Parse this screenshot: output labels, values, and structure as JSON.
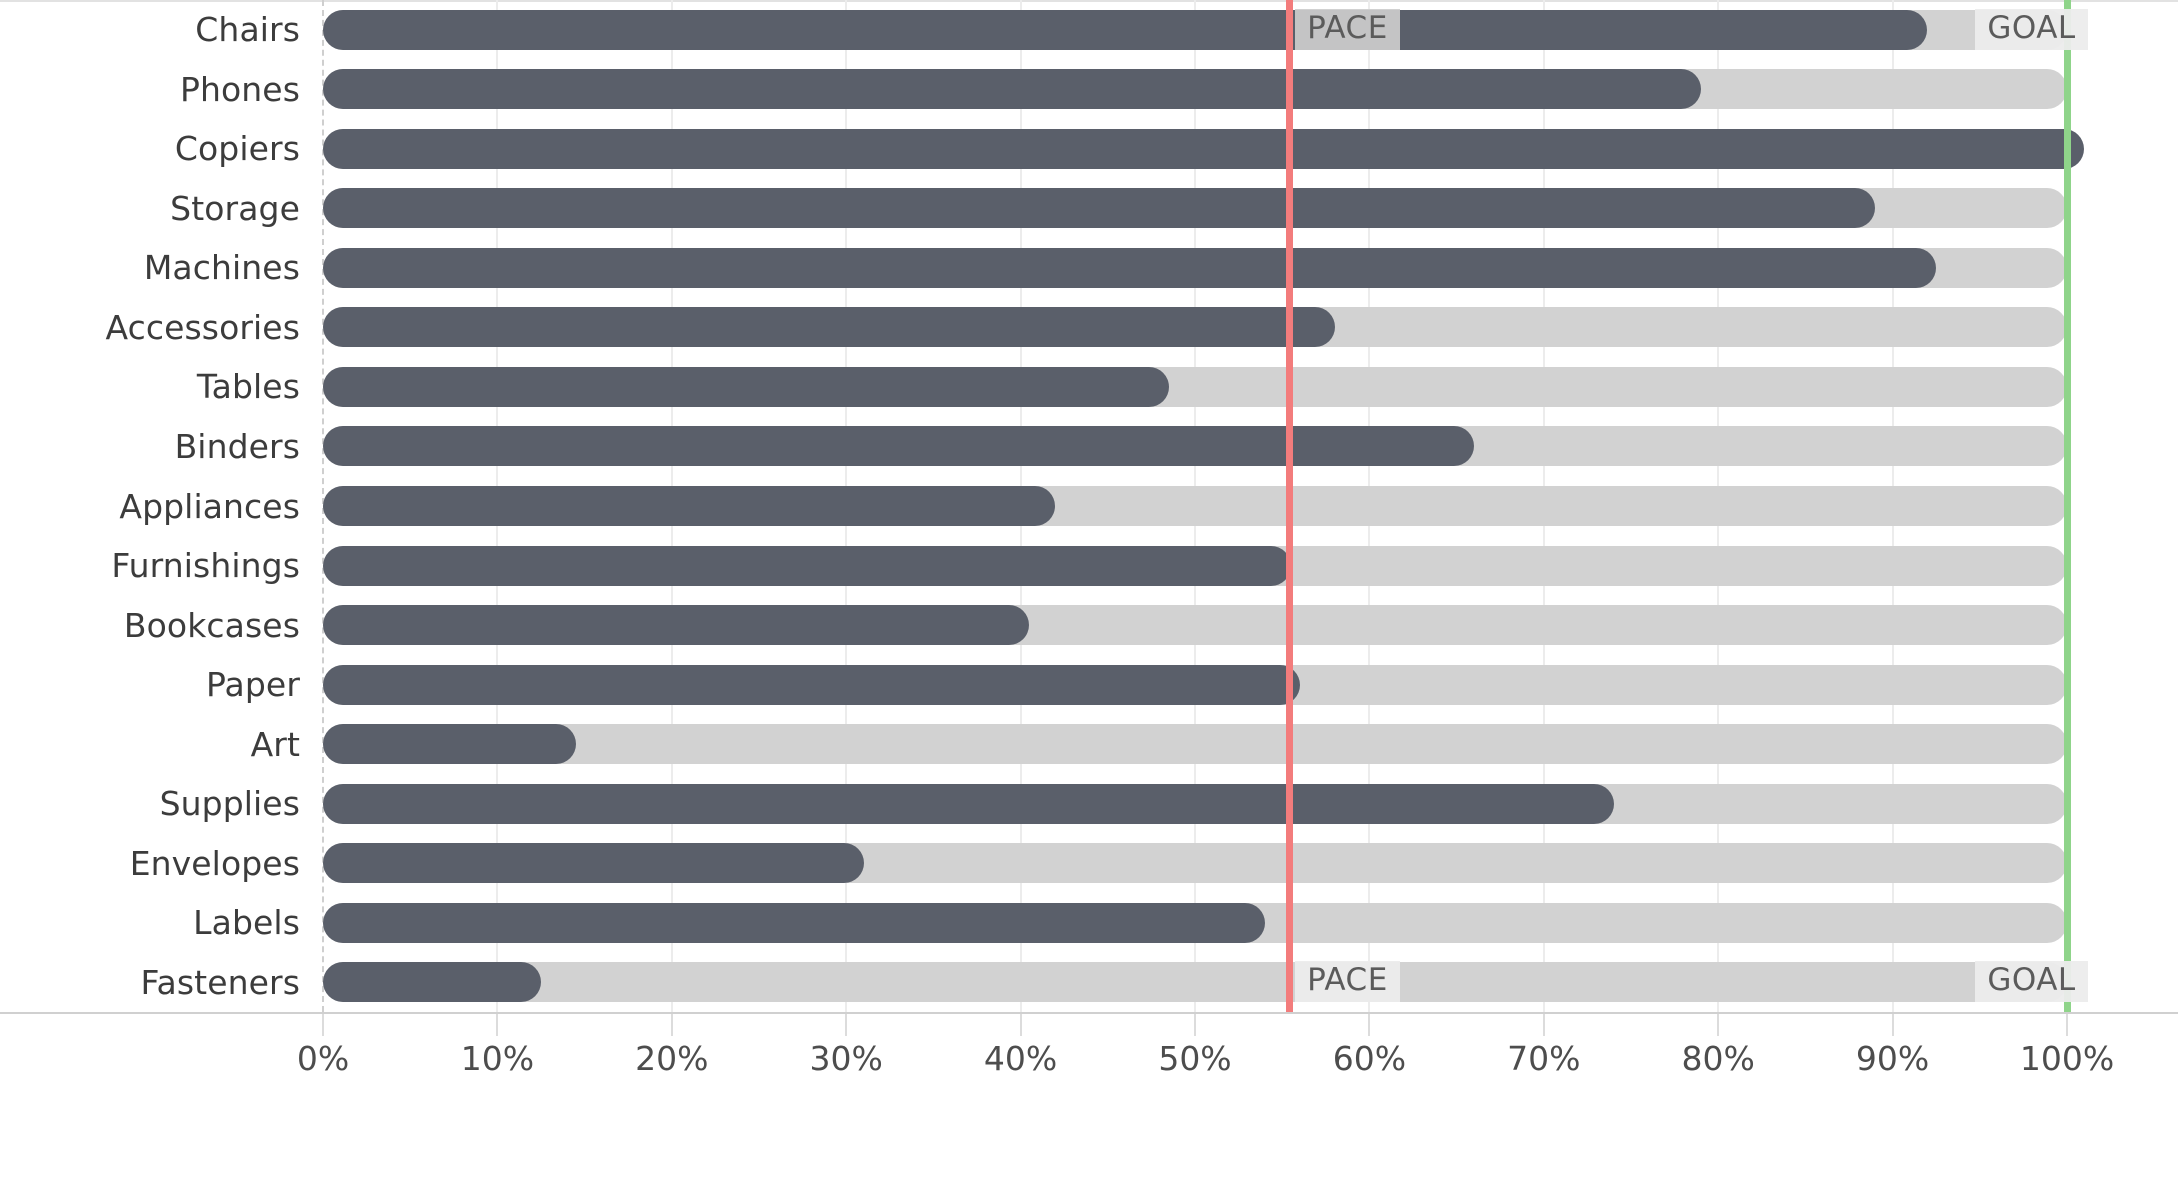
{
  "chart_data": {
    "type": "bar",
    "title": "",
    "subtitle": "",
    "xlabel": "",
    "ylabel": "",
    "orientation": "horizontal",
    "xlim": [
      0,
      100
    ],
    "grid": true,
    "legend_position": "none",
    "x_tick_labels": [
      "0%",
      "10%",
      "20%",
      "30%",
      "40%",
      "50%",
      "60%",
      "70%",
      "80%",
      "90%",
      "100%"
    ],
    "x_tick_values": [
      0,
      10,
      20,
      30,
      40,
      50,
      60,
      70,
      80,
      90,
      100
    ],
    "categories": [
      "Chairs",
      "Phones",
      "Copiers",
      "Storage",
      "Machines",
      "Accessories",
      "Tables",
      "Binders",
      "Appliances",
      "Furnishings",
      "Bookcases",
      "Paper",
      "Art",
      "Supplies",
      "Envelopes",
      "Labels",
      "Fasteners"
    ],
    "values": [
      92,
      79,
      101,
      89,
      92.5,
      58,
      48.5,
      66,
      42,
      55.5,
      40.5,
      56,
      14.5,
      74,
      31,
      54,
      12.5
    ],
    "track_max": 100,
    "reference_lines": [
      {
        "name": "PACE",
        "label": "PACE",
        "value": 55.4,
        "color": "#f37c7c"
      },
      {
        "name": "GOAL",
        "label": "GOAL",
        "value": 100,
        "color": "#8fd48a"
      }
    ],
    "colors": {
      "bar": "#5a5f6a",
      "track": "#d2d2d2",
      "pace_line": "#f37c7c",
      "goal_line": "#8fd48a",
      "gridline": "#ececec",
      "axis": "#d0d0d0",
      "text": "#3c3c3c"
    },
    "annotations": [
      {
        "text": "PACE",
        "row": "Chairs",
        "at_value": 55.4
      },
      {
        "text": "GOAL",
        "row": "Chairs",
        "at_value": 100
      },
      {
        "text": "PACE",
        "row": "Fasteners",
        "at_value": 55.4
      },
      {
        "text": "GOAL",
        "row": "Fasteners",
        "at_value": 100
      }
    ]
  },
  "axis": {
    "ticks": [
      {
        "label": "0%",
        "value": 0
      },
      {
        "label": "10%",
        "value": 10
      },
      {
        "label": "20%",
        "value": 20
      },
      {
        "label": "30%",
        "value": 30
      },
      {
        "label": "40%",
        "value": 40
      },
      {
        "label": "50%",
        "value": 50
      },
      {
        "label": "60%",
        "value": 60
      },
      {
        "label": "70%",
        "value": 70
      },
      {
        "label": "80%",
        "value": 80
      },
      {
        "label": "90%",
        "value": 90
      },
      {
        "label": "100%",
        "value": 100
      }
    ]
  },
  "reference_labels": {
    "pace": "PACE",
    "goal": "GOAL"
  }
}
